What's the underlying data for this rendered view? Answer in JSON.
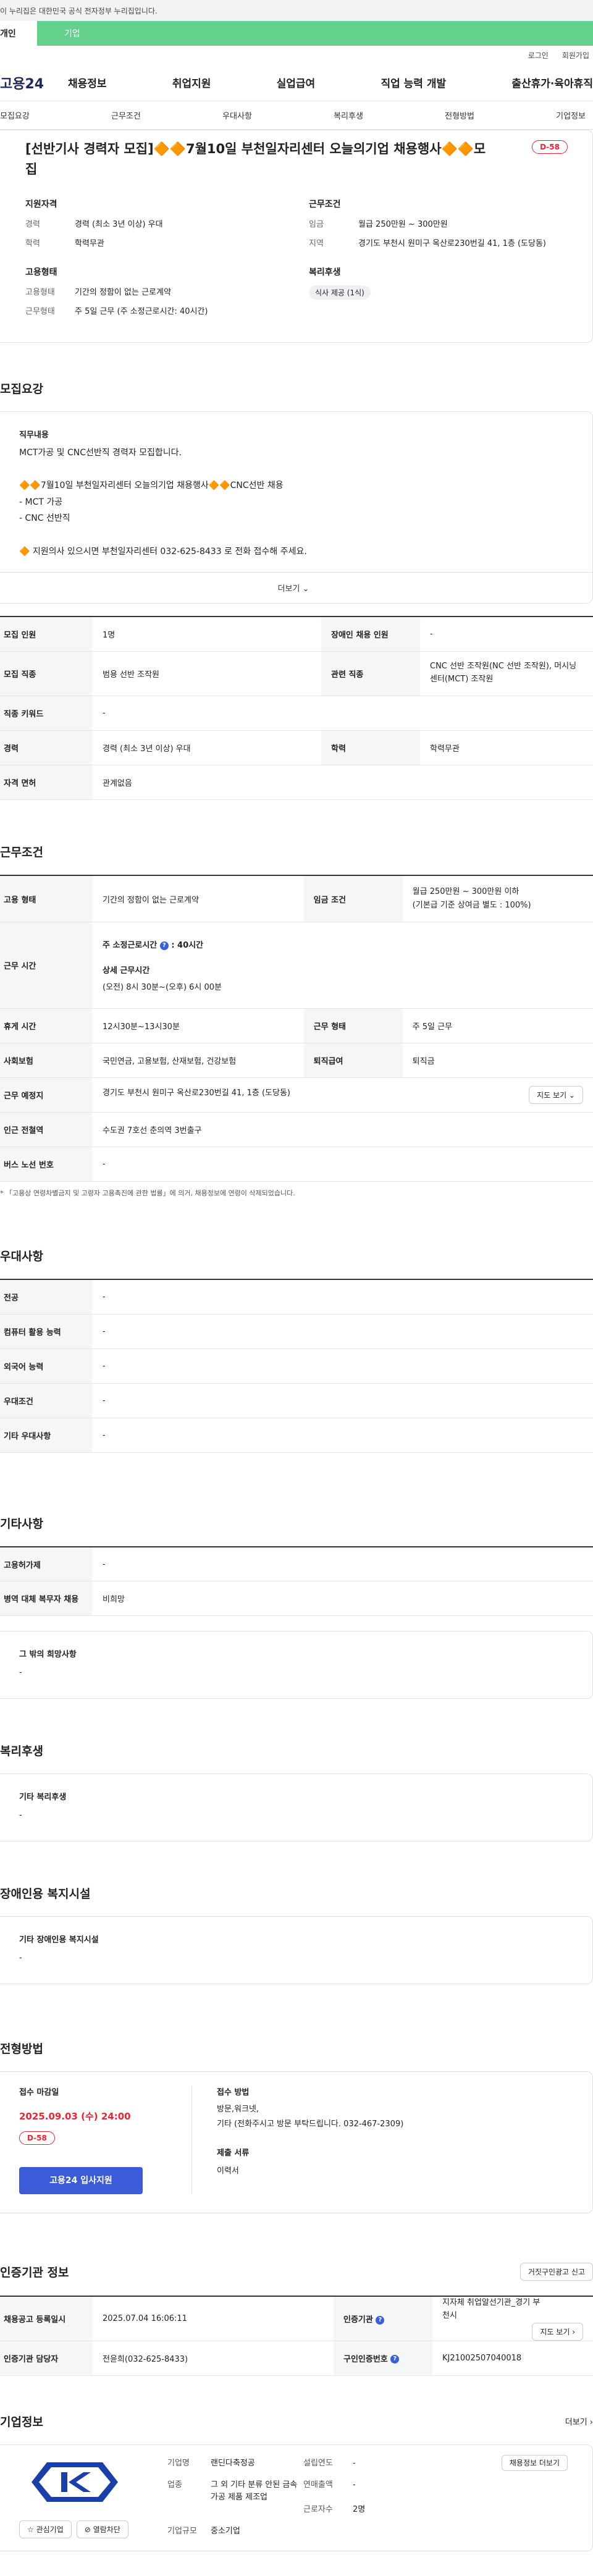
{
  "gov_banner": "이 누리집은 대한민국 공식 전자정부 누리집입니다.",
  "tabs": {
    "personal": "개인",
    "company": "기업"
  },
  "util": {
    "login": "로그인",
    "signup": "회원가입"
  },
  "logo": "고용24",
  "gnb": [
    "채용정보",
    "취업지원",
    "실업급여",
    "직업 능력 개발",
    "출산휴가·육아휴직"
  ],
  "anchors": [
    "모집요강",
    "근무조건",
    "우대사항",
    "복리후생",
    "전형방법",
    "기업정보"
  ],
  "post": {
    "title": "[선반기사 경력자 모집]🔶🔶7월10일 부천일자리센터 오늘의기업 채용행사🔶🔶모집",
    "dday": "D-58",
    "qualification": {
      "heading": "지원자격",
      "career_label": "경력",
      "career": "경력 (최소 3년 이상) 우대",
      "edu_label": "학력",
      "edu": "학력무관"
    },
    "conditions": {
      "heading": "근무조건",
      "wage_label": "임금",
      "wage": "월급 250만원 ~ 300만원",
      "region_label": "지역",
      "region": "경기도 부천시 원미구 옥산로230번길 41, 1층 (도당동)"
    },
    "employment": {
      "heading": "고용형태",
      "type_label": "고용형태",
      "type": "기간의 정함이 없는 근로계약",
      "shape_label": "근무형태",
      "shape": "주 5일 근무 (주 소정근로시간: 40시간)"
    },
    "welfare": {
      "heading": "복리후생",
      "chip": "식사 제공 (1식)"
    }
  },
  "recruit": {
    "title": "모집요강",
    "job_heading": "직무내용",
    "job_desc": "MCT가공 및 CNC선반직 경력자 모집합니다.\n\n🔶🔶7월10일 부천일자리센터 오늘의기업 채용행사🔶🔶CNC선반 채용\n- MCT 가공\n- CNC 선반직\n\n🔶 지원의사 있으시면 부천일자리센터  032-625-8433 로 전화 접수해 주세요.",
    "more": "더보기 ⌄",
    "rows": [
      {
        "k1": "모집 인원",
        "v1": "1명",
        "k2": "장애인 채용 인원",
        "v2": "-"
      },
      {
        "k1": "모집 직종",
        "v1": "범용 선반 조작원",
        "k2": "관련 직종",
        "v2": "CNC 선반 조작원(NC 선반 조작원), 머시닝센터(MCT) 조작원"
      },
      {
        "k1": "직종 키워드",
        "v1": "-"
      },
      {
        "k1": "경력",
        "v1": "경력 (최소 3년 이상) 우대",
        "k2": "학력",
        "v2": "학력무관"
      },
      {
        "k1": "자격 면허",
        "v1": "관계없음"
      }
    ]
  },
  "work": {
    "title": "근무조건",
    "employment_type": {
      "k": "고용 형태",
      "v": "기간의 정함이 없는 근로계약"
    },
    "wage": {
      "k": "임금 조건",
      "v": "월급 250만원 ~ 300만원 이하\n(기본급 기준 상여금 별도 : 100%)"
    },
    "hours": {
      "k": "근무 시간",
      "weekly": "주 소정근로시간",
      "weekly_v": ": 40시간",
      "detail_title": "상세 근무시간",
      "detail": "(오전) 8시 30분~(오후) 6시 00분"
    },
    "break": {
      "k": "휴게 시간",
      "v": "12시30분~13시30분",
      "k2": "근무 형태",
      "v2": "주 5일 근무"
    },
    "insurance": {
      "k": "사회보험",
      "v": "국민연금, 고용보험, 산재보험, 건강보험",
      "k2": "퇴직급여",
      "v2": "퇴직금"
    },
    "location": {
      "k": "근무 예정지",
      "v": "경기도 부천시 원미구 옥산로230번길 41, 1층 (도당동)",
      "btn": "지도 보기 ⌄"
    },
    "subway": {
      "k": "인근 전철역",
      "v": "수도권 7호선 춘의역 3번출구"
    },
    "bus": {
      "k": "버스 노선 번호",
      "v": "-"
    },
    "note": "* 「고용상 연령차별금지 및 고령자 고용촉진에 관한 법률」에 의거, 채용정보에 연령이 삭제되었습니다."
  },
  "preference": {
    "title": "우대사항",
    "rows": [
      {
        "k": "전공",
        "v": "-"
      },
      {
        "k": "컴퓨터 활용 능력",
        "v": "-"
      },
      {
        "k": "외국어 능력",
        "v": "-"
      },
      {
        "k": "우대조건",
        "v": "-"
      },
      {
        "k": "기타 우대사항",
        "v": "-"
      }
    ]
  },
  "etc": {
    "title": "기타사항",
    "rows": [
      {
        "k": "고용허가제",
        "v": "-"
      },
      {
        "k": "병역 대체 복무자 채용",
        "v": "비희망"
      }
    ],
    "other_heading": "그 밖의 희망사항",
    "other_v": "-"
  },
  "benefit": {
    "title": "복리후생",
    "heading": "기타 복리후생",
    "v": "-"
  },
  "disabled": {
    "title": "장애인용 복지시설",
    "heading": "기타 장애인용 복지시설",
    "v": "-"
  },
  "selection": {
    "title": "전형방법",
    "deadline_label": "접수 마감일",
    "deadline": "2025.09.03 (수) 24:00",
    "dday": "D-58",
    "apply_btn": "고용24 입사지원",
    "method_label": "접수 방법",
    "method": "방문,워크넷,\n기타 (전화주시고 방문 부탁드립니다. 032-467-2309)",
    "docs_label": "제출 서류",
    "docs": "이력서"
  },
  "cert": {
    "title": "인증기관 정보",
    "report_btn": "거짓구인광고 신고",
    "rows": [
      {
        "k1": "채용공고 등록일시",
        "v1": "2025.07.04 16:06:11",
        "k2": "인증기관",
        "v2": "지자체 취업알선기관_경기 부천시",
        "btn": "지도 보기 ›"
      },
      {
        "k1": "인증기관 담당자",
        "v1": "전윤희(032-625-8433)",
        "k2": "구인인증번호",
        "v2": "KJ21002507040018"
      }
    ]
  },
  "company": {
    "title": "기업정보",
    "more": "더보기 ›",
    "fav_btn": "☆ 관심기업",
    "block_btn": "⊘ 열람차단",
    "info_btn": "채용정보 더보기",
    "name_label": "기업명",
    "name": "랜딘다축정공",
    "founded_label": "설립연도",
    "founded": "-",
    "industry_label": "업종",
    "industry": "그 외 기타 분류 안된 금속 가공 제품 제조업",
    "sales_label": "연매출액",
    "sales": "-",
    "workers_label": "근로자수",
    "workers": "2명",
    "size_label": "기업규모",
    "size": "중소기업"
  }
}
